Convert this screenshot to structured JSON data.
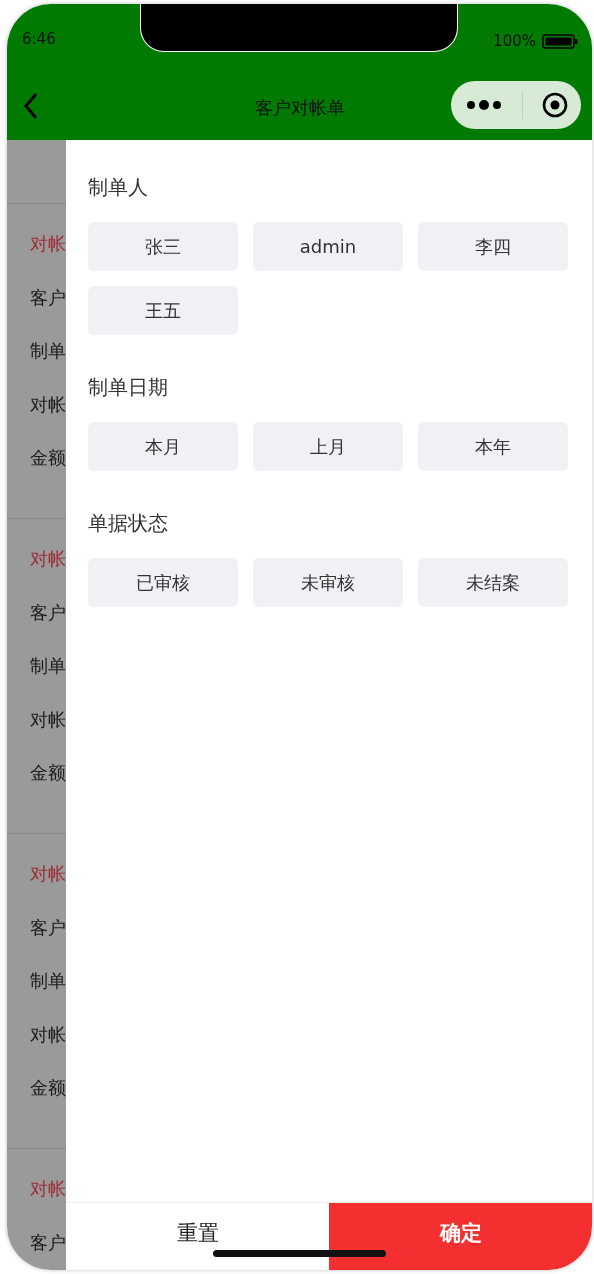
{
  "status_bar": {
    "time": "6:46",
    "battery": "100%"
  },
  "nav": {
    "title": "客户对帐单"
  },
  "background_list": [
    {
      "items": [
        {
          "kind": "title",
          "text": "对帐"
        },
        {
          "kind": "field",
          "text": "客户"
        },
        {
          "kind": "field",
          "text": "制单"
        },
        {
          "kind": "field",
          "text": "对帐"
        },
        {
          "kind": "field",
          "text": "金额"
        }
      ]
    },
    {
      "items": [
        {
          "kind": "title",
          "text": "对帐"
        },
        {
          "kind": "field",
          "text": "客户"
        },
        {
          "kind": "field",
          "text": "制单"
        },
        {
          "kind": "field",
          "text": "对帐"
        },
        {
          "kind": "field",
          "text": "金额"
        }
      ]
    },
    {
      "items": [
        {
          "kind": "title",
          "text": "对帐"
        },
        {
          "kind": "field",
          "text": "客户"
        },
        {
          "kind": "field",
          "text": "制单"
        },
        {
          "kind": "field",
          "text": "对帐"
        },
        {
          "kind": "field",
          "text": "金额"
        }
      ]
    },
    {
      "items": [
        {
          "kind": "title",
          "text": "对帐"
        },
        {
          "kind": "field",
          "text": "客户"
        }
      ]
    }
  ],
  "filter_sections": [
    {
      "title": "制单人",
      "options": [
        {
          "label": "张三",
          "selected": false
        },
        {
          "label": "admin",
          "selected": false
        },
        {
          "label": "李四",
          "selected": false
        },
        {
          "label": "王五",
          "selected": false
        }
      ]
    },
    {
      "title": "制单日期",
      "options": [
        {
          "label": "本月",
          "selected": false
        },
        {
          "label": "上月",
          "selected": false
        },
        {
          "label": "本年",
          "selected": false
        }
      ]
    },
    {
      "title": "单据状态",
      "options": [
        {
          "label": "已审核",
          "selected": false
        },
        {
          "label": "未审核",
          "selected": false
        },
        {
          "label": "未结案",
          "selected": false
        }
      ]
    }
  ],
  "footer_buttons": [
    {
      "kind": "reset",
      "label": "重置"
    },
    {
      "kind": "confirm",
      "label": "确定"
    }
  ]
}
